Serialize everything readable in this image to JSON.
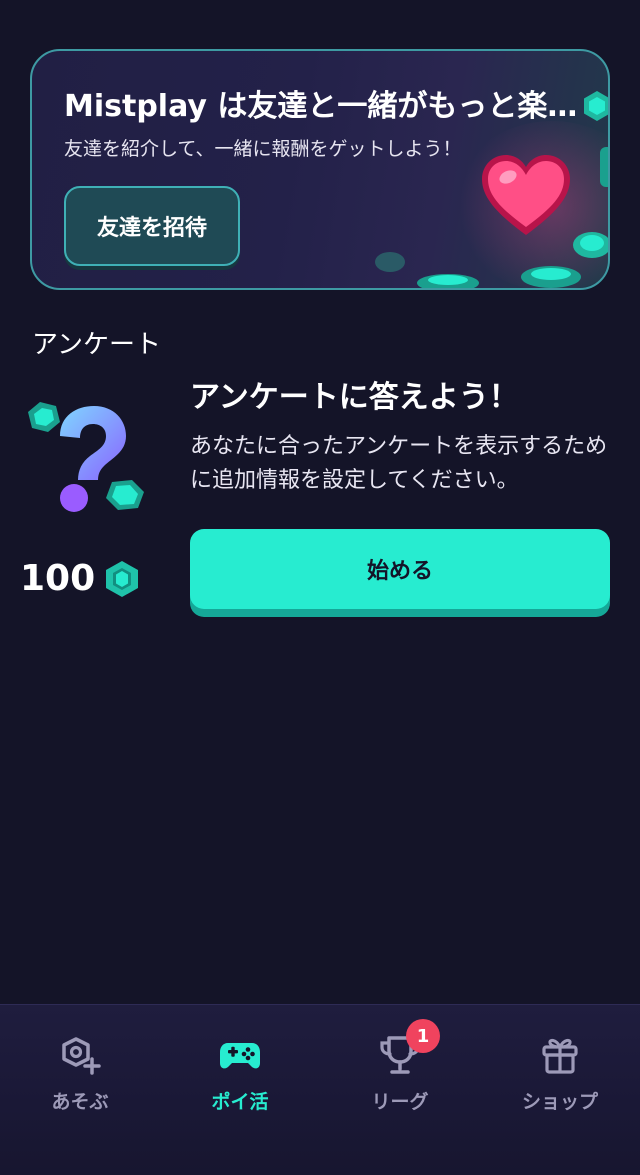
{
  "banner": {
    "title": "Mistplay は友達と一緒がもっと楽…",
    "subtitle": "友達を紹介して、一緒に報酬をゲットしよう！",
    "button_label": "友達を招待"
  },
  "survey_section": {
    "title": "アンケート",
    "heading": "アンケートに答えよう！",
    "description": "あなたに合ったアンケートを表示するために追加情報を設定してください。",
    "reward_amount": "100",
    "start_button_label": "始める"
  },
  "tabbar": {
    "tabs": [
      {
        "label": "あそぶ",
        "icon": "gamepad-plus-icon",
        "active": false
      },
      {
        "label": "ポイ活",
        "icon": "controller-icon",
        "active": true
      },
      {
        "label": "リーグ",
        "icon": "trophy-icon",
        "active": false,
        "badge": "1"
      },
      {
        "label": "ショップ",
        "icon": "gift-icon",
        "active": false
      }
    ]
  },
  "colors": {
    "background": "#141428",
    "accent": "#27ecd0",
    "badge": "#f0435e",
    "inactive_tab": "#9d9ab8"
  }
}
